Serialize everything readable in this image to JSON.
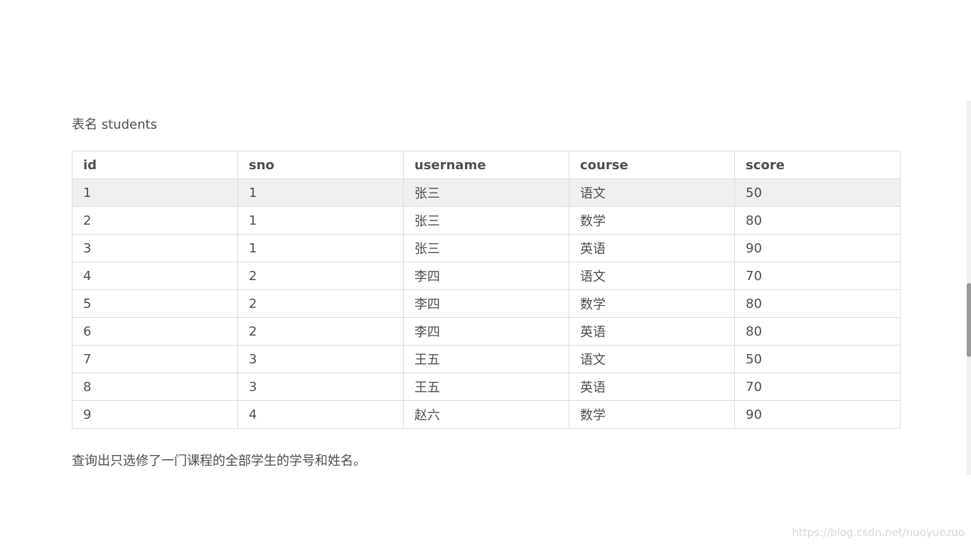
{
  "caption": "表名 students",
  "table": {
    "headers": [
      "id",
      "sno",
      "username",
      "course",
      "score"
    ],
    "rows": [
      [
        "1",
        "1",
        "张三",
        "语文",
        "50"
      ],
      [
        "2",
        "1",
        "张三",
        "数学",
        "80"
      ],
      [
        "3",
        "1",
        "张三",
        "英语",
        "90"
      ],
      [
        "4",
        "2",
        "李四",
        "语文",
        "70"
      ],
      [
        "5",
        "2",
        "李四",
        "数学",
        "80"
      ],
      [
        "6",
        "2",
        "李四",
        "英语",
        "80"
      ],
      [
        "7",
        "3",
        "王五",
        "语文",
        "50"
      ],
      [
        "8",
        "3",
        "王五",
        "英语",
        "70"
      ],
      [
        "9",
        "4",
        "赵六",
        "数学",
        "90"
      ]
    ],
    "highlighted_row": 0
  },
  "question": "查询出只选修了一门课程的全部学生的学号和姓名。",
  "watermark": "https://blog.csdn.net/nuoyuezuo",
  "colors": {
    "text": "#4d4d4d",
    "border": "#dddddd",
    "highlight_row": "#f0f0f0",
    "scroll_thumb": "#9a9a9a"
  }
}
